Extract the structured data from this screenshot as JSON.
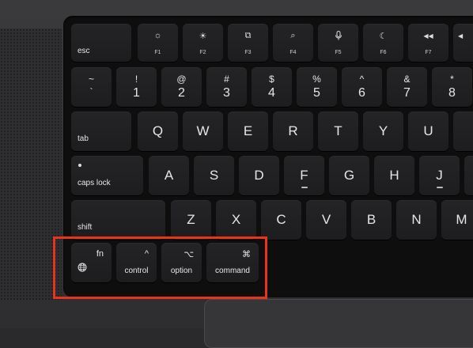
{
  "rows": {
    "fn_row": [
      {
        "name": "esc-key",
        "label": "esc"
      },
      {
        "name": "f1-key",
        "label": "F1",
        "icon": "☼",
        "icon_name": "brightness-down-icon"
      },
      {
        "name": "f2-key",
        "label": "F2",
        "icon": "☀",
        "icon_name": "brightness-up-icon"
      },
      {
        "name": "f3-key",
        "label": "F3",
        "icon": "⧉",
        "icon_name": "mission-control-icon"
      },
      {
        "name": "f4-key",
        "label": "F4",
        "icon": "⌕",
        "icon_name": "search-icon"
      },
      {
        "name": "f5-key",
        "label": "F5",
        "icon": "🎙",
        "icon_name": "microphone-icon"
      },
      {
        "name": "f6-key",
        "label": "F6",
        "icon": "☾",
        "icon_name": "moon-icon"
      },
      {
        "name": "f7-key",
        "label": "F7",
        "icon": "◀◀",
        "icon_name": "rewind-icon"
      },
      {
        "name": "f8-key",
        "label": "",
        "icon": "",
        "icon_name": "partial-key"
      }
    ],
    "number_row": [
      {
        "top": "~",
        "bottom": "`"
      },
      {
        "top": "!",
        "bottom": "1"
      },
      {
        "top": "@",
        "bottom": "2"
      },
      {
        "top": "#",
        "bottom": "3"
      },
      {
        "top": "$",
        "bottom": "4"
      },
      {
        "top": "%",
        "bottom": "5"
      },
      {
        "top": "^",
        "bottom": "6"
      },
      {
        "top": "&",
        "bottom": "7"
      },
      {
        "top": "*",
        "bottom": "8"
      }
    ],
    "qwerty_row": {
      "tab": "tab",
      "letters": [
        "Q",
        "W",
        "E",
        "R",
        "T",
        "Y",
        "U",
        ""
      ]
    },
    "home_row": {
      "caps": "caps lock",
      "letters": [
        "A",
        "S",
        "D",
        "F",
        "G",
        "H",
        "J"
      ]
    },
    "bottom_letter_row": {
      "shift": "shift",
      "letters": [
        "Z",
        "X",
        "C",
        "V",
        "B",
        "N",
        "M"
      ]
    },
    "modifier_row": {
      "fn": "fn",
      "globe_icon": "globe-icon",
      "control_sym": "^",
      "control": "control",
      "option_sym": "⌥",
      "option": "option",
      "command_sym": "⌘",
      "command": "command"
    }
  },
  "highlight_color": "#e8341c"
}
